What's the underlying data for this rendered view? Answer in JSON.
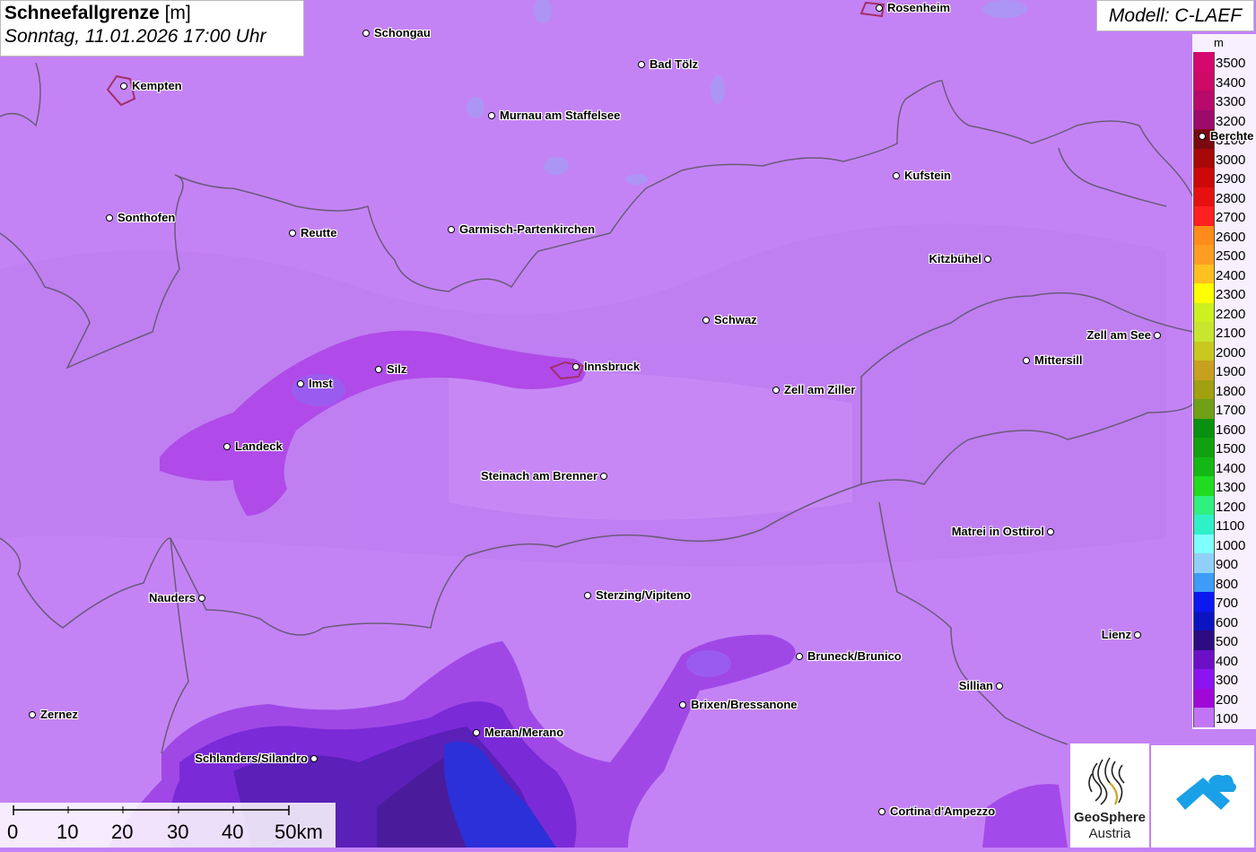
{
  "title": {
    "main": "Schneefallgrenze",
    "unit": "[m]",
    "datetime": "Sonntag, 11.01.2026 17:00 Uhr"
  },
  "model": "Modell: C-LAEF",
  "legend": {
    "unit": "m",
    "entries": [
      {
        "label": "3500",
        "color": "#d4086e"
      },
      {
        "label": "3400",
        "color": "#cc0a66"
      },
      {
        "label": "3300",
        "color": "#b80a6a"
      },
      {
        "label": "3200",
        "color": "#9c0a6c"
      },
      {
        "label": "3100",
        "color": "#7a0a10"
      },
      {
        "label": "3000",
        "color": "#a80808"
      },
      {
        "label": "2900",
        "color": "#cc0808"
      },
      {
        "label": "2800",
        "color": "#e61010"
      },
      {
        "label": "2700",
        "color": "#ff2020"
      },
      {
        "label": "2600",
        "color": "#ff8c1a"
      },
      {
        "label": "2500",
        "color": "#ff9c22"
      },
      {
        "label": "2400",
        "color": "#ffc020"
      },
      {
        "label": "2300",
        "color": "#ffff00"
      },
      {
        "label": "2200",
        "color": "#ccf020"
      },
      {
        "label": "2100",
        "color": "#c8e630"
      },
      {
        "label": "2000",
        "color": "#c8c820"
      },
      {
        "label": "1900",
        "color": "#c8a020"
      },
      {
        "label": "1800",
        "color": "#a0a010"
      },
      {
        "label": "1700",
        "color": "#70a018"
      },
      {
        "label": "1600",
        "color": "#089010"
      },
      {
        "label": "1500",
        "color": "#10a010"
      },
      {
        "label": "1400",
        "color": "#14b814"
      },
      {
        "label": "1300",
        "color": "#20dc20"
      },
      {
        "label": "1200",
        "color": "#30f080"
      },
      {
        "label": "1100",
        "color": "#30f0c8"
      },
      {
        "label": "1000",
        "color": "#80ffff"
      },
      {
        "label": "900",
        "color": "#90d0f8"
      },
      {
        "label": "800",
        "color": "#3c9cf8"
      },
      {
        "label": "700",
        "color": "#0c18f0"
      },
      {
        "label": "600",
        "color": "#0c14c0"
      },
      {
        "label": "500",
        "color": "#2c0c80"
      },
      {
        "label": "400",
        "color": "#6c10c8"
      },
      {
        "label": "300",
        "color": "#8c14f0"
      },
      {
        "label": "200",
        "color": "#a008d8"
      },
      {
        "label": "100",
        "color": "#c076f4"
      }
    ]
  },
  "cities": [
    {
      "name": "Rosenheim",
      "label_side": "right"
    },
    {
      "name": "Schongau",
      "label_side": "right"
    },
    {
      "name": "Kempten",
      "label_side": "right"
    },
    {
      "name": "Bad Tölz",
      "label_side": "right"
    },
    {
      "name": "Murnau am Staffelsee",
      "label_side": "right"
    },
    {
      "name": "Berchte",
      "label_side": "right"
    },
    {
      "name": "Kufstein",
      "label_side": "right"
    },
    {
      "name": "Sonthofen",
      "label_side": "right"
    },
    {
      "name": "Reutte",
      "label_side": "right"
    },
    {
      "name": "Garmisch-Partenkirchen",
      "label_side": "right"
    },
    {
      "name": "Kitzbühel",
      "label_side": "left"
    },
    {
      "name": "Schwaz",
      "label_side": "right"
    },
    {
      "name": "Zell am See",
      "label_side": "left"
    },
    {
      "name": "Mittersill",
      "label_side": "right"
    },
    {
      "name": "Imst",
      "label_side": "right"
    },
    {
      "name": "Silz",
      "label_side": "right"
    },
    {
      "name": "Innsbruck",
      "label_side": "right"
    },
    {
      "name": "Zell am Ziller",
      "label_side": "right"
    },
    {
      "name": "Landeck",
      "label_side": "right"
    },
    {
      "name": "Steinach am Brenner",
      "label_side": "left"
    },
    {
      "name": "Matrei in Osttirol",
      "label_side": "left"
    },
    {
      "name": "Nauders",
      "label_side": "left"
    },
    {
      "name": "Sterzing/Vipiteno",
      "label_side": "right"
    },
    {
      "name": "Lienz",
      "label_side": "left"
    },
    {
      "name": "Bruneck/Brunico",
      "label_side": "right"
    },
    {
      "name": "Brixen/Bressanone",
      "label_side": "right"
    },
    {
      "name": "Sillian",
      "label_side": "left"
    },
    {
      "name": "Zernez",
      "label_side": "right"
    },
    {
      "name": "Meran/Merano",
      "label_side": "right"
    },
    {
      "name": "Schlanders/Silandro",
      "label_side": "left"
    },
    {
      "name": "Cortina d'Ampezzo",
      "label_side": "right"
    }
  ],
  "scale": {
    "labels": [
      "0",
      "10",
      "20",
      "30",
      "40",
      "50km"
    ]
  },
  "logo": {
    "name_line1": "GeoSphere",
    "name_line2": "Austria"
  }
}
